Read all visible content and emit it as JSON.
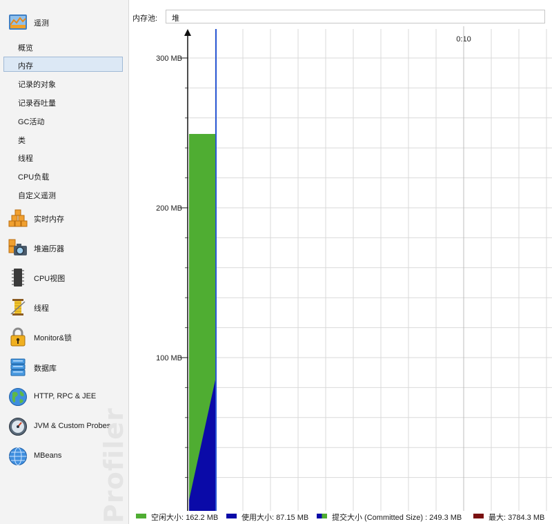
{
  "sidebar": {
    "telemetry": {
      "label": "遥测",
      "icon": "telemetry-icon"
    },
    "subitems": [
      {
        "label": "概览"
      },
      {
        "label": "内存",
        "selected": true
      },
      {
        "label": "记录的对象"
      },
      {
        "label": "记录吞吐量"
      },
      {
        "label": "GC活动"
      },
      {
        "label": "类"
      },
      {
        "label": "线程"
      },
      {
        "label": "CPU负载"
      },
      {
        "label": "自定义遥测"
      }
    ],
    "categories": [
      {
        "label": "实时内存",
        "icon": "live-memory-icon"
      },
      {
        "label": "堆遍历器",
        "icon": "heap-walker-icon"
      },
      {
        "label": "CPU视图",
        "icon": "cpu-views-icon"
      },
      {
        "label": "线程",
        "icon": "threads-icon"
      },
      {
        "label": "Monitor&锁",
        "icon": "lock-icon"
      },
      {
        "label": "数据库",
        "icon": "database-icon"
      },
      {
        "label": "HTTP, RPC & JEE",
        "icon": "globe-icon"
      },
      {
        "label": "JVM & Custom Probes",
        "icon": "gauge-icon"
      },
      {
        "label": "MBeans",
        "icon": "mbeans-globe-icon"
      }
    ],
    "watermark": "Profiler"
  },
  "toolbar": {
    "pool_label": "内存池:",
    "pool_value": "堆"
  },
  "colors": {
    "free": "#4fad32",
    "used": "#0a0aa8",
    "committed_marker": "#2b58d6",
    "max": "#7a1010",
    "grid": "#d9d9d9"
  },
  "chart_data": {
    "type": "area",
    "ylabel": "",
    "xlabel": "",
    "yunit": "MB",
    "ylim": [
      0,
      320
    ],
    "yticks": [
      {
        "value": 100,
        "label": "100 MB"
      },
      {
        "value": 200,
        "label": "200 MB"
      },
      {
        "value": 300,
        "label": "300 MB"
      }
    ],
    "xtick_label": "0:10",
    "committed_mb": 249.3,
    "used_start_mb": 5,
    "used_end_mb": 87.15,
    "grid": true,
    "legend_position": "bottom",
    "legend": [
      {
        "name": "空闲大小",
        "text": "空闲大小: 162.2 MB",
        "swatch": "free"
      },
      {
        "name": "使用大小",
        "text": "使用大小: 87.15 MB",
        "swatch": "used"
      },
      {
        "name": "提交大小",
        "text": "提交大小 (Committed Size) : 249.3 MB",
        "swatch": "committed"
      },
      {
        "name": "最大",
        "text": "最大: 3784.3 MB",
        "swatch": "max"
      }
    ]
  }
}
